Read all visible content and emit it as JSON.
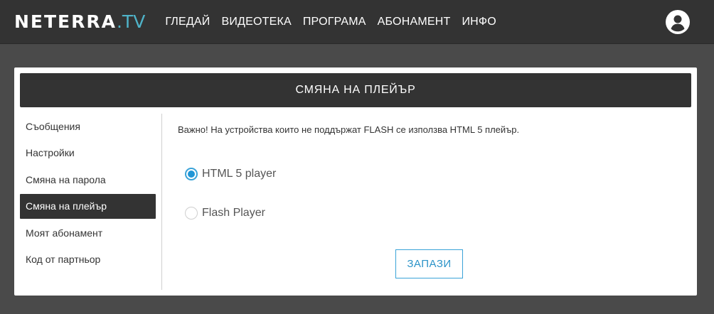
{
  "header": {
    "logo_main": "NETERRA",
    "logo_suffix": ".TV",
    "nav": [
      "ГЛЕДАЙ",
      "ВИДЕОТЕКА",
      "ПРОГРАМА",
      "АБОНАМЕНТ",
      "ИНФО"
    ],
    "user_icon": "account-circle-icon"
  },
  "panel": {
    "title": "СМЯНА НА ПЛЕЙЪР"
  },
  "sidebar": {
    "items": [
      {
        "label": "Съобщения",
        "active": false
      },
      {
        "label": "Настройки",
        "active": false
      },
      {
        "label": "Смяна на парола",
        "active": false
      },
      {
        "label": "Смяна на плейър",
        "active": true
      },
      {
        "label": "Моят абонамент",
        "active": false
      },
      {
        "label": "Код от партньор",
        "active": false
      }
    ]
  },
  "content": {
    "notice": "Важно! На устройства които не поддържат FLASH се използва HTML 5 плейър.",
    "options": [
      {
        "label": "HTML 5 player",
        "checked": true
      },
      {
        "label": "Flash Player",
        "checked": false
      }
    ],
    "save_label": "ЗАПАЗИ"
  },
  "colors": {
    "topbar": "#333333",
    "background": "#4a4a4a",
    "accent": "#3aa3d8",
    "logo_accent": "#4fb3c8"
  }
}
